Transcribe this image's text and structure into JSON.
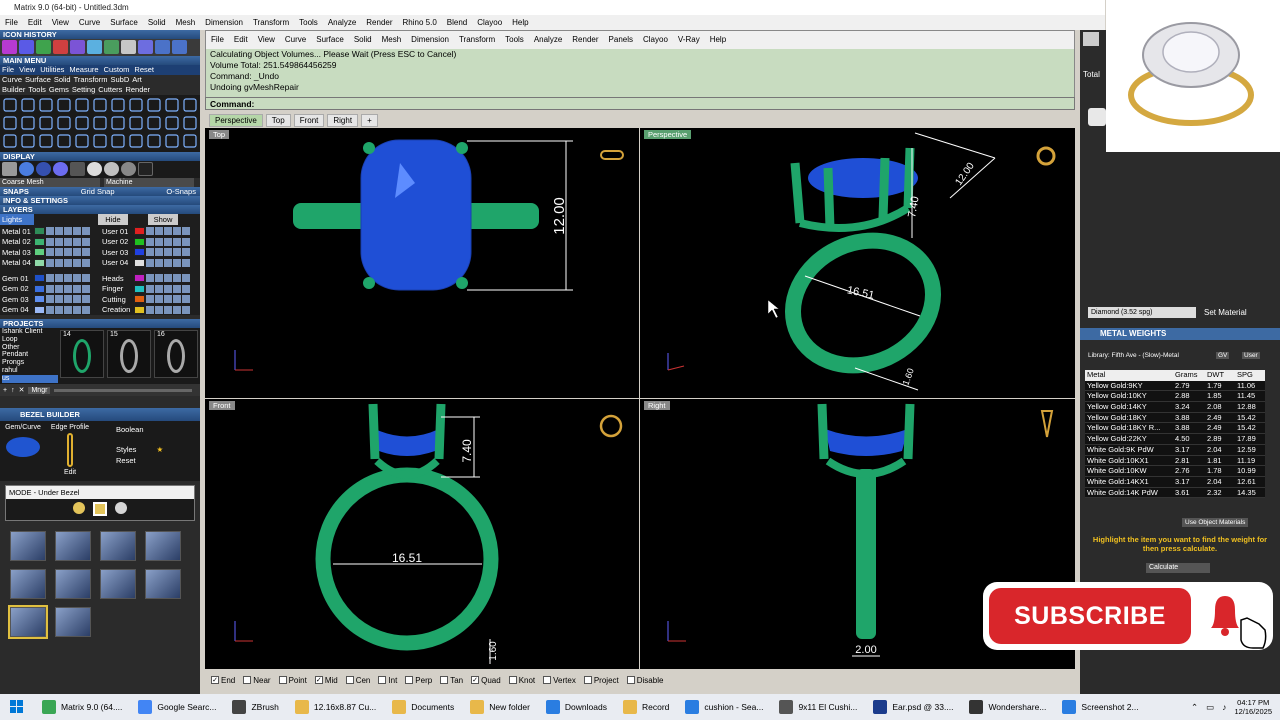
{
  "window": {
    "title": "Matrix 9.0 (64-bit) - Untitled.3dm"
  },
  "app_menu": [
    "File",
    "Edit",
    "View",
    "Curve",
    "Surface",
    "Solid",
    "Mesh",
    "Dimension",
    "Transform",
    "Tools",
    "Analyze",
    "Render",
    "Rhino 5.0",
    "Blend",
    "Clayoo",
    "Help"
  ],
  "left": {
    "icon_history": "ICON HISTORY",
    "main_menu": "MAIN MENU",
    "main_menu_items": [
      "File",
      "View",
      "Utilities",
      "Measure",
      "Custom",
      "Reset"
    ],
    "main_menu_row2": [
      "Curve",
      "Surface",
      "Solid",
      "Transform",
      "SubD",
      "Art"
    ],
    "main_menu_row3": [
      "Builder",
      "Tools",
      "Gems",
      "Setting",
      "Cutters",
      "Render"
    ],
    "display": "DISPLAY",
    "coarse_mesh": "Coarse Mesh",
    "machine": "Machine",
    "snaps": "SNAPS",
    "grid_snap": "Grid Snap",
    "o_snaps": "O-Snaps",
    "info_settings": "INFO & SETTINGS",
    "layers": "LAYERS",
    "lights": "Lights",
    "hide": "Hide",
    "show": "Show",
    "layers_left": [
      {
        "name": "Metal 01",
        "color": "#2e8b57"
      },
      {
        "name": "Metal 02",
        "color": "#3cb371"
      },
      {
        "name": "Metal 03",
        "color": "#5fcf80"
      },
      {
        "name": "Metal 04",
        "color": "#8fd9a8"
      },
      {
        "name": "Gem 01",
        "color": "#1e50c8"
      },
      {
        "name": "Gem 02",
        "color": "#3a6fe0"
      },
      {
        "name": "Gem 03",
        "color": "#5f8ff0"
      },
      {
        "name": "Gem 04",
        "color": "#9ab8f5"
      }
    ],
    "layers_right": [
      {
        "name": "User 01",
        "color": "#e02020"
      },
      {
        "name": "User 02",
        "color": "#20c020"
      },
      {
        "name": "User 03",
        "color": "#2040e0"
      },
      {
        "name": "User 04",
        "color": "#e0e0e0"
      },
      {
        "name": "Heads",
        "color": "#c020c0"
      },
      {
        "name": "Finger",
        "color": "#20c0c0"
      },
      {
        "name": "Cutting",
        "color": "#e06010"
      },
      {
        "name": "Creation",
        "color": "#e0c020"
      }
    ],
    "projects": "PROJECTS",
    "project_list": [
      "Ishank Client",
      "Loop",
      "Other",
      "Pendant",
      "Prongs",
      "rahul",
      "us"
    ],
    "project_thumbs": [
      "14",
      "15",
      "16"
    ],
    "mngr": "Mngr",
    "bezel_builder": "BEZEL BUILDER",
    "gem_curve": "Gem/Curve",
    "edge_profile": "Edge Profile",
    "boolean": "Boolean",
    "styles": "Styles",
    "reset": "Reset",
    "edit": "Edit",
    "mode": "MODE - Under Bezel"
  },
  "command": {
    "menu": [
      "File",
      "Edit",
      "View",
      "Curve",
      "Surface",
      "Solid",
      "Mesh",
      "Dimension",
      "Transform",
      "Tools",
      "Analyze",
      "Render",
      "Panels",
      "Clayoo",
      "V-Ray",
      "Help"
    ],
    "history": [
      "Calculating Object Volumes... Please Wait (Press ESC to Cancel)",
      "Volume Total: 251.549864456259",
      "Command: _Undo",
      "Undoing gvMeshRepair"
    ],
    "prompt": "Command:"
  },
  "viewport_tabs": [
    "Perspective",
    "Top",
    "Front",
    "Right",
    "+"
  ],
  "viewports": {
    "top": {
      "label": "Top",
      "dim": "12.00"
    },
    "perspective": {
      "label": "Perspective",
      "dim_a": "16.51",
      "dim_b": "7.40",
      "dim_c": "12.00",
      "dim_d": "1.60"
    },
    "front": {
      "label": "Front",
      "dim_a": "16.51",
      "dim_b": "7.40",
      "dim_c": "1.60"
    },
    "right": {
      "label": "Right",
      "dim": "2.00"
    }
  },
  "osnaps": [
    {
      "label": "End",
      "checked": true
    },
    {
      "label": "Near",
      "checked": false
    },
    {
      "label": "Point",
      "checked": false
    },
    {
      "label": "Mid",
      "checked": true
    },
    {
      "label": "Cen",
      "checked": false
    },
    {
      "label": "Int",
      "checked": false
    },
    {
      "label": "Perp",
      "checked": false
    },
    {
      "label": "Tan",
      "checked": false
    },
    {
      "label": "Quad",
      "checked": true
    },
    {
      "label": "Knot",
      "checked": false
    },
    {
      "label": "Vertex",
      "checked": false
    },
    {
      "label": "Project",
      "checked": false
    },
    {
      "label": "Disable",
      "checked": false
    }
  ],
  "right": {
    "total": "Total",
    "diamond": "Diamond  (3.52 spg)",
    "set_material": "Set Material",
    "metal_weights": "METAL WEIGHTS",
    "library": "Library: Fifth Ave - (Slow)-Metal",
    "gv": "GV",
    "user": "User",
    "columns": [
      "Metal",
      "Grams",
      "DWT",
      "SPG"
    ],
    "rows": [
      [
        "Yellow Gold:9KY",
        "2.79",
        "1.79",
        "11.06"
      ],
      [
        "Yellow Gold:10KY",
        "2.88",
        "1.85",
        "11.45"
      ],
      [
        "Yellow Gold:14KY",
        "3.24",
        "2.08",
        "12.88"
      ],
      [
        "Yellow Gold:18KY",
        "3.88",
        "2.49",
        "15.42"
      ],
      [
        "Yellow Gold:18KY R...",
        "3.88",
        "2.49",
        "15.42"
      ],
      [
        "Yellow Gold:22KY",
        "4.50",
        "2.89",
        "17.89"
      ],
      [
        "White Gold:9K PdW",
        "3.17",
        "2.04",
        "12.59"
      ],
      [
        "White Gold:10KX1",
        "2.81",
        "1.81",
        "11.19"
      ],
      [
        "White Gold:10KW",
        "2.76",
        "1.78",
        "10.99"
      ],
      [
        "White Gold:14KX1",
        "3.17",
        "2.04",
        "12.61"
      ],
      [
        "White Gold:14K PdW",
        "3.61",
        "2.32",
        "14.35"
      ]
    ],
    "use_object_materials": "Use Object Materials",
    "hint": "Highlight the item you want to find the weight for then press calculate.",
    "calculate": "Calculate"
  },
  "overlay": {
    "subscribe": "SUBSCRIBE"
  },
  "taskbar": {
    "items": [
      {
        "label": "Matrix 9.0 (64....",
        "color": "#3aa655"
      },
      {
        "label": "Google Searc...",
        "color": "#4285f4"
      },
      {
        "label": "ZBrush",
        "color": "#444"
      },
      {
        "label": "12.16x8.87 Cu...",
        "color": "#e8b84a"
      },
      {
        "label": "Documents",
        "color": "#e8b84a"
      },
      {
        "label": "New folder",
        "color": "#e8b84a"
      },
      {
        "label": "Downloads",
        "color": "#2a7de1"
      },
      {
        "label": "Record",
        "color": "#e8b84a"
      },
      {
        "label": "cushion - Sea...",
        "color": "#2a7de1"
      },
      {
        "label": "9x11 El Cushi...",
        "color": "#555"
      },
      {
        "label": "Ear.psd @ 33....",
        "color": "#1b3b8c"
      },
      {
        "label": "Wondershare...",
        "color": "#333"
      },
      {
        "label": "Screenshot 2...",
        "color": "#2a7de1"
      }
    ],
    "time": "04:17 PM",
    "date": "12/16/2025"
  },
  "colors": {
    "metal": "#1fa56a",
    "gem": "#1f4fd6",
    "panel": "#2b2b2b",
    "command_bg": "#c8dcc0"
  }
}
